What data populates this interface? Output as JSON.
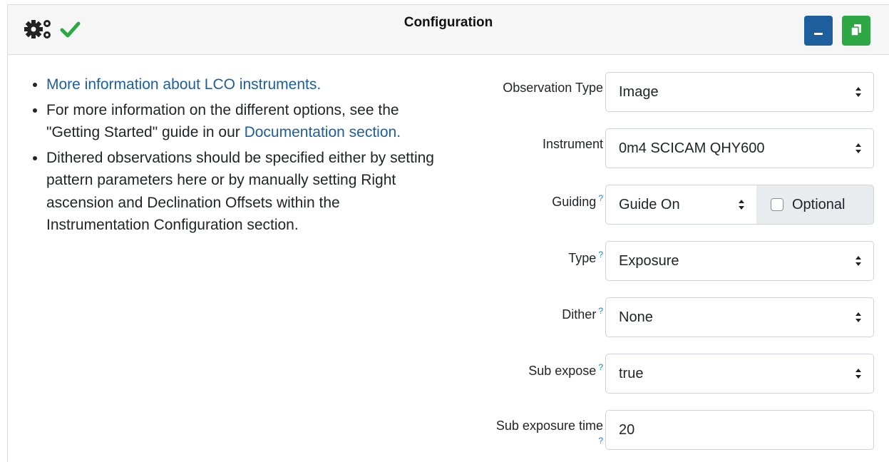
{
  "header": {
    "title": "Configuration",
    "icons": [
      "gears-icon",
      "check-icon",
      "minimize-icon",
      "copy-icon"
    ],
    "colors": {
      "minimize_button": "#1d5e9c",
      "copy_button": "#2ea745",
      "check": "#2ea745",
      "link": "#1d5e9c"
    }
  },
  "info": {
    "item1_link": "More information about LCO instruments.",
    "item2_text": "For more information on the different options, see the \"Getting Started\" guide in our ",
    "item2_link": "Documentation section.",
    "item3_text": "Dithered observations should be specified either by setting pattern parameters here or by manually setting Right ascension and Declination Offsets within the Instrumentation Configuration section."
  },
  "form": {
    "help_mark": "?",
    "observation_type": {
      "label": "Observation Type",
      "value": "Image"
    },
    "instrument": {
      "label": "Instrument",
      "value": "0m4 SCICAM QHY600"
    },
    "guiding": {
      "label": "Guiding",
      "value": "Guide On",
      "optional_label": "Optional"
    },
    "type": {
      "label": "Type",
      "value": "Exposure"
    },
    "dither": {
      "label": "Dither",
      "value": "None"
    },
    "sub_expose": {
      "label": "Sub expose",
      "value": "true"
    },
    "sub_exposure_time": {
      "label": "Sub exposure time",
      "value": "20"
    }
  }
}
